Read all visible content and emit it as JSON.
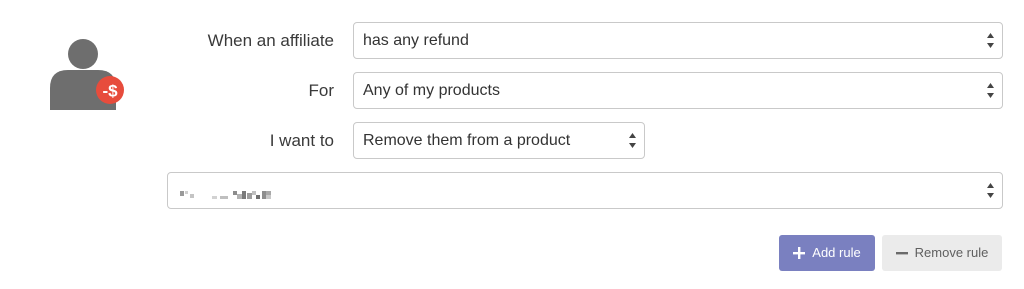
{
  "avatar": {
    "badge_text": "-$",
    "badge_color": "#e74c3c",
    "person_color": "#6e6e6e",
    "icon": "affiliate-refund-icon"
  },
  "rule": {
    "trigger": {
      "label": "When an affiliate",
      "selected": "has any refund"
    },
    "scope": {
      "label": "For",
      "selected": "Any of my products"
    },
    "action": {
      "label": "I want to",
      "selected": "Remove them from a product"
    },
    "product": {
      "selected": "[blurred]"
    }
  },
  "buttons": {
    "add_rule": "Add rule",
    "remove_rule": "Remove rule"
  },
  "colors": {
    "add_button": "#7a80c0",
    "remove_button": "#ebebeb"
  }
}
